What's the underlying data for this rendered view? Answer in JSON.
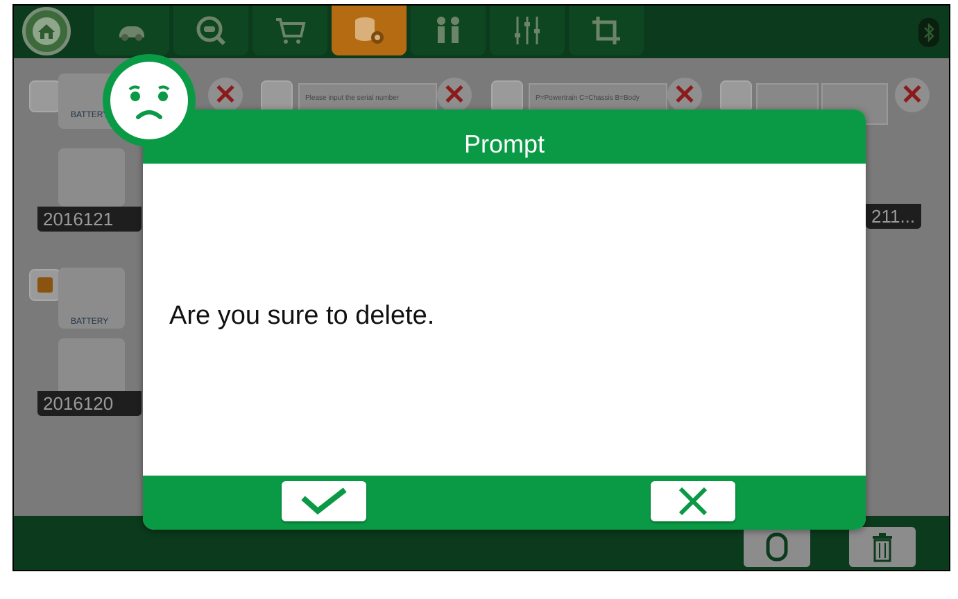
{
  "toolbar": {
    "tabs": [
      {
        "icon": "home-icon",
        "active": false
      },
      {
        "icon": "car-icon",
        "active": false
      },
      {
        "icon": "car-search-icon",
        "active": false
      },
      {
        "icon": "shopping-cart-icon",
        "active": false
      },
      {
        "icon": "database-settings-icon",
        "active": true
      },
      {
        "icon": "people-icon",
        "active": false
      },
      {
        "icon": "sliders-icon",
        "active": false
      },
      {
        "icon": "crop-icon",
        "active": false
      }
    ],
    "active_color": "#b56b12",
    "bluetooth_icon": "bluetooth-icon"
  },
  "background": {
    "items": [
      {
        "label": "BATTERY",
        "date": "2016121"
      },
      {
        "label": "BATTERY",
        "date": "2016120"
      }
    ],
    "thumb_texts": [
      "Please input the serial number",
      "P=Powertrain  C=Chassis  B=Body"
    ],
    "last_label": "211..."
  },
  "dialog": {
    "title": "Prompt",
    "message": "Are you sure to delete.",
    "confirm_icon": "check-icon",
    "cancel_icon": "close-icon",
    "accent": "#0a9a45",
    "face_icon": "sad-face-icon"
  },
  "bottom": {
    "buttons": [
      "select-all-icon",
      "trash-icon"
    ]
  }
}
